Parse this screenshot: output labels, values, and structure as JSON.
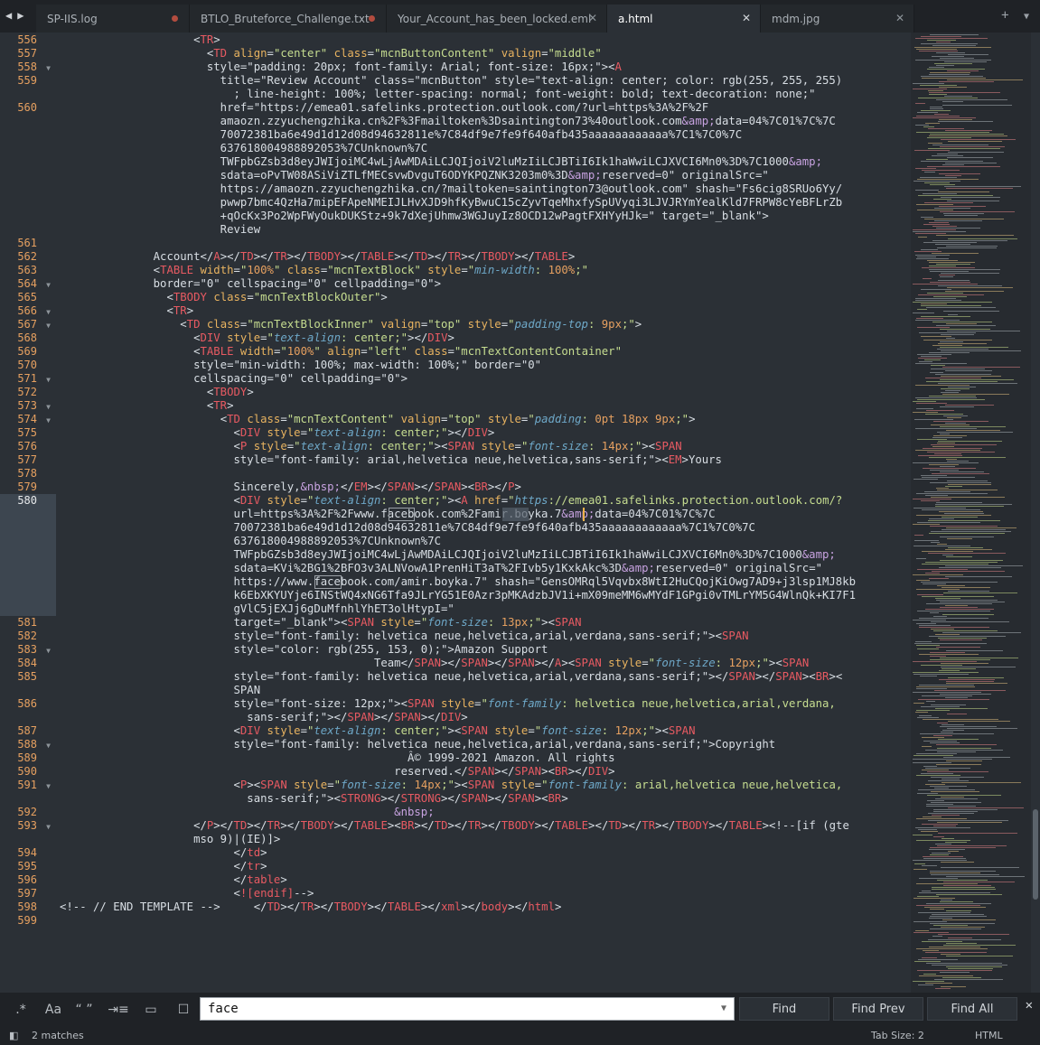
{
  "tabs": [
    {
      "label": "SP-IIS.log",
      "state": "modified"
    },
    {
      "label": "BTLO_Bruteforce_Challenge.txt",
      "state": "modified"
    },
    {
      "label": "Your_Account_has_been_locked.eml",
      "state": "close"
    },
    {
      "label": "a.html",
      "state": "active"
    },
    {
      "label": "mdm.jpg",
      "state": "close"
    }
  ],
  "tabbar": {
    "new_tab_icon": "+",
    "tab_list_icon": "▼"
  },
  "editor": {
    "highlighted_line": "580",
    "lines": [
      {
        "n": "556",
        "fold": ""
      },
      {
        "n": "557",
        "fold": ""
      },
      {
        "n": "558",
        "fold": "▼"
      },
      {
        "n": "559",
        "fold": ""
      },
      {
        "n": "",
        "fold": ""
      },
      {
        "n": "560",
        "fold": ""
      },
      {
        "n": "",
        "fold": ""
      },
      {
        "n": "",
        "fold": ""
      },
      {
        "n": "",
        "fold": ""
      },
      {
        "n": "",
        "fold": ""
      },
      {
        "n": "",
        "fold": ""
      },
      {
        "n": "",
        "fold": ""
      },
      {
        "n": "",
        "fold": ""
      },
      {
        "n": "",
        "fold": ""
      },
      {
        "n": "",
        "fold": ""
      },
      {
        "n": "561",
        "fold": ""
      },
      {
        "n": "562",
        "fold": ""
      },
      {
        "n": "563",
        "fold": ""
      },
      {
        "n": "564",
        "fold": "▼"
      },
      {
        "n": "565",
        "fold": ""
      },
      {
        "n": "566",
        "fold": "▼"
      },
      {
        "n": "567",
        "fold": "▼"
      },
      {
        "n": "568",
        "fold": ""
      },
      {
        "n": "569",
        "fold": ""
      },
      {
        "n": "570",
        "fold": ""
      },
      {
        "n": "571",
        "fold": "▼"
      },
      {
        "n": "572",
        "fold": ""
      },
      {
        "n": "573",
        "fold": "▼"
      },
      {
        "n": "574",
        "fold": "▼"
      },
      {
        "n": "575",
        "fold": ""
      },
      {
        "n": "576",
        "fold": ""
      },
      {
        "n": "577",
        "fold": ""
      },
      {
        "n": "578",
        "fold": ""
      },
      {
        "n": "579",
        "fold": ""
      },
      {
        "n": "580",
        "fold": ""
      },
      {
        "n": "",
        "fold": ""
      },
      {
        "n": "",
        "fold": ""
      },
      {
        "n": "",
        "fold": ""
      },
      {
        "n": "",
        "fold": ""
      },
      {
        "n": "",
        "fold": ""
      },
      {
        "n": "",
        "fold": ""
      },
      {
        "n": "",
        "fold": ""
      },
      {
        "n": "",
        "fold": ""
      },
      {
        "n": "581",
        "fold": ""
      },
      {
        "n": "582",
        "fold": ""
      },
      {
        "n": "583",
        "fold": "▼"
      },
      {
        "n": "584",
        "fold": ""
      },
      {
        "n": "585",
        "fold": ""
      },
      {
        "n": "",
        "fold": ""
      },
      {
        "n": "586",
        "fold": ""
      },
      {
        "n": "",
        "fold": ""
      },
      {
        "n": "587",
        "fold": ""
      },
      {
        "n": "588",
        "fold": "▼"
      },
      {
        "n": "589",
        "fold": ""
      },
      {
        "n": "590",
        "fold": ""
      },
      {
        "n": "591",
        "fold": "▼"
      },
      {
        "n": "",
        "fold": ""
      },
      {
        "n": "592",
        "fold": ""
      },
      {
        "n": "593",
        "fold": "▼"
      },
      {
        "n": "",
        "fold": ""
      },
      {
        "n": "594",
        "fold": ""
      },
      {
        "n": "595",
        "fold": ""
      },
      {
        "n": "596",
        "fold": ""
      },
      {
        "n": "597",
        "fold": ""
      },
      {
        "n": "598",
        "fold": ""
      },
      {
        "n": "599",
        "fold": ""
      }
    ],
    "code": [
      "                    <TR>",
      "                      <TD align=\"center\" class=\"mcnButtonContent\" valign=\"middle\"",
      "                      style=\"padding: 20px; font-family: Arial; font-size: 16px;\"><A",
      "                        title=\"Review Account\" class=\"mcnButton\" style=\"text-align: center; color: rgb(255, 255, 255)",
      "                          ; line-height: 100%; letter-spacing: normal; font-weight: bold; text-decoration: none;\"",
      "                        href=\"https://emea01.safelinks.protection.outlook.com/?url=https%3A%2F%2F",
      "                        amaozn.zzyuchengzhika.cn%2F%3Fmailtoken%3Dsaintington73%40outlook.com&amp;data=04%7C01%7C%7C",
      "                        70072381ba6e49d1d12d08d94632811e%7C84df9e7fe9f640afb435aaaaaaaaaaaa%7C1%7C0%7C",
      "                        637618004988892053%7CUnknown%7C",
      "                        TWFpbGZsb3d8eyJWIjoiMC4wLjAwMDAiLCJQIjoiV2luMzIiLCJBTiI6Ik1haWwiLCJXVCI6Mn0%3D%7C1000&amp;",
      "                        sdata=oPvTW08ASiViZTLfMECsvwDvguT6ODYKPQZNK3203m0%3D&amp;reserved=0\" originalSrc=\"",
      "                        https://amaozn.zzyuchengzhika.cn/?mailtoken=saintington73@outlook.com\" shash=\"Fs6cig8SRUo6Yy/",
      "                        pwwp7bmc4QzHa7mipEFApeNMEIJLHvXJD9hfKyBwuC15cZyvTqeMhxfySpUVyqi3LJVJRYmYealKld7FRPW8cYeBFLrZb",
      "                        +qOcKx3Po2WpFWyOukDUKStz+9k7dXejUhmw3WGJuyIz8OCD12wPagtFXHYyHJk=\" target=\"_blank\">",
      "                        Review",
      "",
      "              Account</A></TD></TR></TBODY></TABLE></TD></TR></TBODY></TABLE>",
      "              <TABLE width=\"100%\" class=\"mcnTextBlock\" style=\"min-width: 100%;\"",
      "              border=\"0\" cellspacing=\"0\" cellpadding=\"0\">",
      "                <TBODY class=\"mcnTextBlockOuter\">",
      "                <TR>",
      "                  <TD class=\"mcnTextBlockInner\" valign=\"top\" style=\"padding-top: 9px;\">",
      "                    <DIV style=\"text-align: center;\"></DIV>",
      "                    <TABLE width=\"100%\" align=\"left\" class=\"mcnTextContentContainer\"",
      "                    style=\"min-width: 100%; max-width: 100%;\" border=\"0\"",
      "                    cellspacing=\"0\" cellpadding=\"0\">",
      "                      <TBODY>",
      "                      <TR>",
      "                        <TD class=\"mcnTextContent\" valign=\"top\" style=\"padding: 0pt 18px 9px;\">",
      "                          <DIV style=\"text-align: center;\"></DIV>",
      "                          <P style=\"text-align: center;\"><SPAN style=\"font-size: 14px;\"><SPAN",
      "                          style=\"font-family: arial,helvetica neue,helvetica,sans-serif;\"><EM>Yours",
      "",
      "                          Sincerely,&nbsp;</EM></SPAN></SPAN><BR></P>",
      "                          <DIV style=\"text-align: center;\"><A href=\"https://emea01.safelinks.protection.outlook.com/?",
      "                          url=https%3A%2F%2Fwww.facebook.com%2Famir.boyka.7&amp;data=04%7C01%7C%7C",
      "                          70072381ba6e49d1d12d08d94632811e%7C84df9e7fe9f640afb435aaaaaaaaaaaa%7C1%7C0%7C",
      "                          637618004988892053%7CUnknown%7C",
      "                          TWFpbGZsb3d8eyJWIjoiMC4wLjAwMDAiLCJQIjoiV2luMzIiLCJBTiI6Ik1haWwiLCJXVCI6Mn0%3D%7C1000&amp;",
      "                          sdata=KVi%2BG1%2BFO3v3ALNVowA1PrenHiT3aT%2FIvb5y1KxkAkc%3D&amp;reserved=0\" originalSrc=\"",
      "                          https://www.facebook.com/amir.boyka.7\" shash=\"GensOMRql5Vqvbx8WtI2HuCQojKiOwg7AD9+j3lsp1MJ8kb",
      "                          k6EbXKYUYje6INStWQ4xNG6Tfa9JLrYG51E0Azr3pMKAdzbJV1i+mX09meMM6wMYdF1GPgi0vTMLrYM5G4WlnQk+KI7F1",
      "                          gVlC5jEXJj6gDuMfnhlYhET3olHtypI=\"",
      "                          target=\"_blank\"><SPAN style=\"font-size: 13px;\"><SPAN",
      "                          style=\"font-family: helvetica neue,helvetica,arial,verdana,sans-serif;\"><SPAN",
      "                          style=\"color: rgb(255, 153, 0);\">Amazon Support",
      "                                               Team</SPAN></SPAN></SPAN></A><SPAN style=\"font-size: 12px;\"><SPAN",
      "                          style=\"font-family: helvetica neue,helvetica,arial,verdana,sans-serif;\"></SPAN></SPAN><BR><",
      "                          SPAN",
      "                          style=\"font-size: 12px;\"><SPAN style=\"font-family: helvetica neue,helvetica,arial,verdana,",
      "                            sans-serif;\"></SPAN></SPAN></DIV>",
      "                          <DIV style=\"text-align: center;\"><SPAN style=\"font-size: 12px;\"><SPAN",
      "                          style=\"font-family: helvetica neue,helvetica,arial,verdana,sans-serif;\">Copyright",
      "                                                    Â© 1999-2021 Amazon. All rights",
      "                                                  reserved.</SPAN></SPAN><BR></DIV>",
      "                          <P><SPAN style=\"font-size: 14px;\"><SPAN style=\"font-family: arial,helvetica neue,helvetica,",
      "                            sans-serif;\"><STRONG></STRONG></SPAN></SPAN><BR>",
      "                                                  &nbsp;",
      "                    </P></TD></TR></TBODY></TABLE><BR></TD></TR></TBODY></TABLE></TD></TR></TBODY></TABLE><!--[if (gte",
      "                    mso 9)|(IE)]>",
      "                          </td>",
      "                          </tr>",
      "                          </table>",
      "                          <![endif]-->",
      "<!-- // END TEMPLATE -->     </TD></TR></TBODY></TABLE></xml></body></html>",
      ""
    ]
  },
  "find": {
    "options": [
      {
        "label": ".*",
        "name": "regex-toggle"
      },
      {
        "label": "Aa",
        "name": "case-sensitive-toggle"
      },
      {
        "label": "“ ”",
        "name": "whole-word-toggle"
      },
      {
        "label": "⇥≡",
        "name": "wrap-toggle"
      },
      {
        "label": "▭",
        "name": "in-selection-toggle"
      },
      {
        "label": "☐",
        "name": "highlight-matches-toggle"
      }
    ],
    "query": "face",
    "dropdown_icon": "▼",
    "find_label": "Find",
    "find_prev_label": "Find Prev",
    "find_all_label": "Find All",
    "close_icon": "✕"
  },
  "status": {
    "matches": "2 matches",
    "tab_size": "Tab Size: 2",
    "syntax": "HTML"
  }
}
